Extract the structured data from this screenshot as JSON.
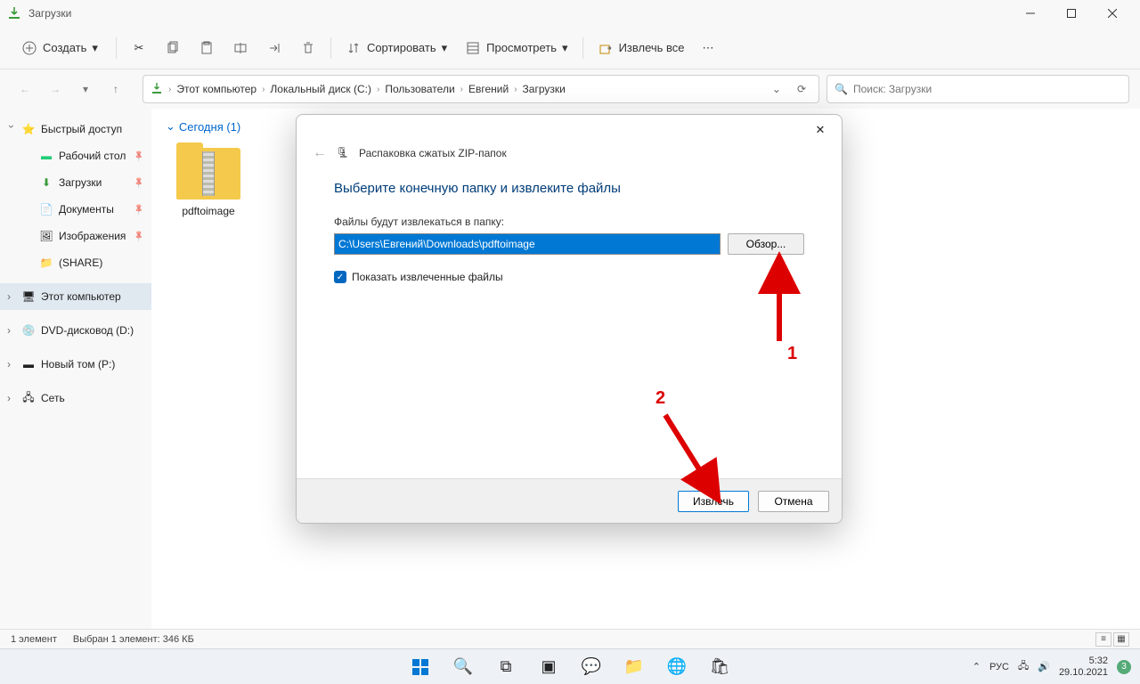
{
  "window": {
    "title": "Загрузки"
  },
  "toolbar": {
    "create": "Создать",
    "sort": "Сортировать",
    "view": "Просмотреть",
    "extract_all": "Извлечь все"
  },
  "breadcrumb": {
    "items": [
      "Этот компьютер",
      "Локальный диск (C:)",
      "Пользователи",
      "Евгений",
      "Загрузки"
    ]
  },
  "search": {
    "placeholder": "Поиск: Загрузки"
  },
  "sidebar": {
    "quick_access": "Быстрый доступ",
    "desktop": "Рабочий стол",
    "downloads": "Загрузки",
    "documents": "Документы",
    "pictures": "Изображения",
    "share": "(SHARE)",
    "this_pc": "Этот компьютер",
    "dvd": "DVD-дисковод (D:)",
    "new_volume": "Новый том (P:)",
    "network": "Сеть"
  },
  "content": {
    "group_header": "Сегодня (1)",
    "file_name": "pdftoimage"
  },
  "status": {
    "count": "1 элемент",
    "selection": "Выбран 1 элемент: 346 КБ"
  },
  "dialog": {
    "header_title": "Распаковка сжатых ZIP-папок",
    "heading": "Выберите конечную папку и извлеките файлы",
    "path_label": "Файлы будут извлекаться в папку:",
    "path_value": "C:\\Users\\Евгений\\Downloads\\pdftoimage",
    "browse": "Обзор...",
    "show_extracted": "Показать извлеченные файлы",
    "extract": "Извлечь",
    "cancel": "Отмена"
  },
  "taskbar": {
    "lang": "РУС",
    "time": "5:32",
    "date": "29.10.2021",
    "notif": "3"
  },
  "annotations": {
    "n1": "1",
    "n2": "2"
  }
}
